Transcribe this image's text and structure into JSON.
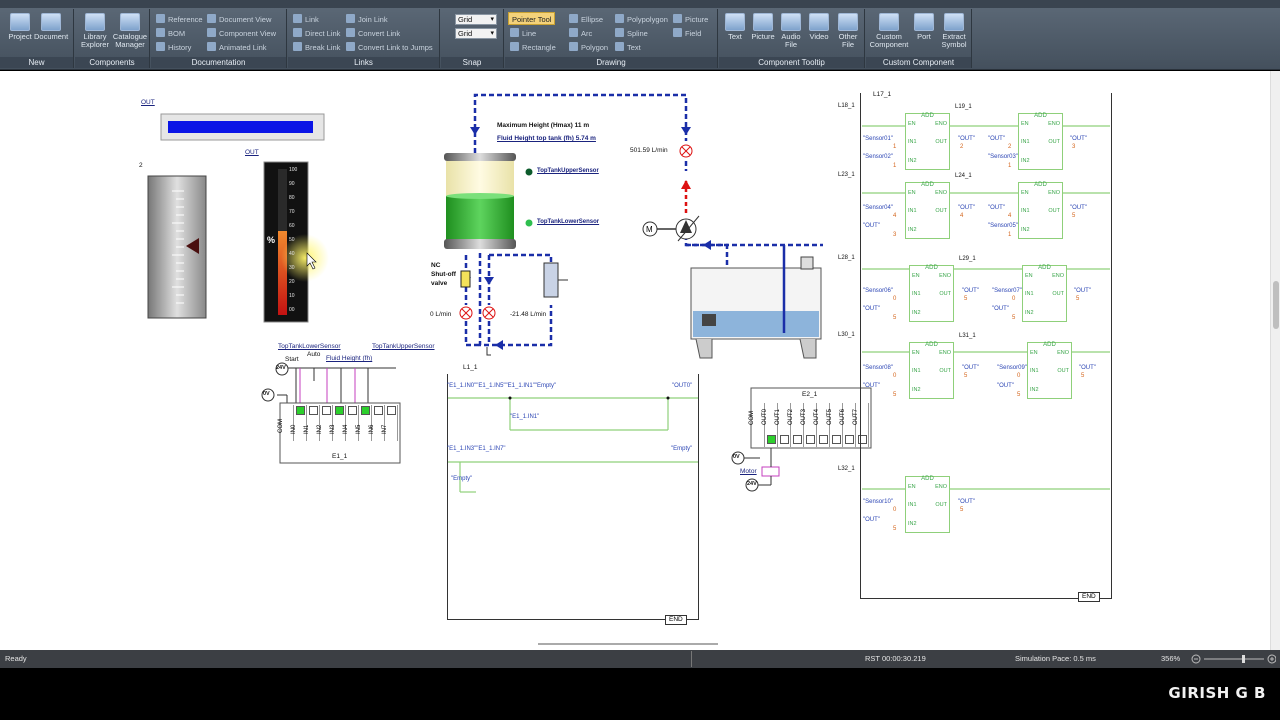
{
  "ribbon": {
    "groups": [
      {
        "title": "New",
        "buttons": [
          "Project",
          "Document"
        ]
      },
      {
        "title": "Components",
        "buttons": [
          "Library Explorer",
          "Catalogue Manager"
        ]
      },
      {
        "title": "Documentation",
        "small": [
          "Reference",
          "BOM",
          "History",
          "Document View",
          "Component View",
          "Animated Link"
        ]
      },
      {
        "title": "Links",
        "small": [
          "Link",
          "Direct Link",
          "Break Link",
          "Join Link",
          "Convert Link",
          "Convert Link to Jumps"
        ]
      },
      {
        "title": "Snap",
        "combos": [
          "Grid",
          "Grid"
        ]
      },
      {
        "title": "Drawing",
        "small": [
          "Pointer Tool",
          "Line",
          "Rectangle",
          "Ellipse",
          "Arc",
          "Polygon",
          "Polypolygon",
          "Spline",
          "Text",
          "Picture",
          "Field"
        ]
      },
      {
        "title": "Component Tooltip",
        "buttons": [
          "Text",
          "Picture",
          "Audio File",
          "Video",
          "Other File"
        ]
      },
      {
        "title": "Custom Component",
        "buttons": [
          "Custom Component",
          "Port",
          "Extract Symbol"
        ]
      }
    ]
  },
  "canvas": {
    "out_label_1": "OUT",
    "out_label_2": "OUT",
    "gauge_number": "2",
    "bargraph_unit": "%",
    "bargraph_ticks": [
      "100",
      "90",
      "80",
      "70",
      "60",
      "50",
      "40",
      "30",
      "20",
      "10",
      "00"
    ],
    "tank": {
      "max_height": "Maximum Height (Hmax) 11 m",
      "fluid_height_top": "Fluid Height top tank (fh) 5.74 m",
      "upper_sensor": "TopTankUpperSensor",
      "lower_sensor": "TopTankLowerSensor",
      "valve_label": [
        "NC",
        "Shut-off",
        "valve"
      ],
      "flow_left": "0 L/min",
      "flow_right": "-21.48 L/min",
      "flow_top": "501.59 L/min"
    },
    "io_panel": {
      "lower_sensor": "TopTankLowerSensor",
      "upper_sensor": "TopTankUpperSensor",
      "start": "Start",
      "auto": "Auto",
      "fluid_height": "Fluid Height (fh)",
      "v24": "24V",
      "v0": "0V",
      "module": "E1_1",
      "com": "COM",
      "inputs": [
        "IN0",
        "IN1",
        "IN2",
        "IN3",
        "IN4",
        "IN5",
        "IN6",
        "IN7"
      ],
      "active": [
        true,
        false,
        false,
        true,
        false,
        true,
        false,
        false
      ]
    },
    "ladder_middle": {
      "name": "L1_1",
      "row1": "\"E1_1.IN0\"\"E1_1.IN5\"\"E1_1.IN1\"\"Empty\"",
      "row1_out": "\"OUT0\"",
      "row2": "\"E1_1.IN1\"",
      "row3": "\"E1_1.IN3\"\"E1_1.IN7\"",
      "row3_out": "\"Empty\"",
      "row4": "\"Empty\"",
      "end": "END"
    },
    "out_module": {
      "module": "E2_1",
      "com": "COM",
      "outputs": [
        "OUT0",
        "OUT1",
        "OUT2",
        "OUT3",
        "OUT4",
        "OUT5",
        "OUT6",
        "OUT7"
      ],
      "v0": "0V",
      "v24": "24V",
      "motor": "Motor"
    },
    "ladder_right": {
      "rungs": [
        {
          "name": "L18_1",
          "blk2": "L19_1",
          "in1": "\"Sensor01\"",
          "in2": "\"Sensor02\"",
          "v1": "1",
          "v2": "1",
          "out": "\"OUT\"",
          "outv": "2",
          "in3": "\"OUT\"",
          "in4": "\"Sensor03\"",
          "v3": "2",
          "v4": "1",
          "out2": "\"OUT\"",
          "outv2": "3"
        },
        {
          "name": "L23_1",
          "blk2": "L24_1",
          "in1": "\"Sensor04\"",
          "in2": "\"OUT\"",
          "v1": "4",
          "v2": "3",
          "out": "\"OUT\"",
          "outv": "4",
          "in3": "\"OUT\"",
          "in4": "\"Sensor05\"",
          "v3": "4",
          "v4": "1",
          "out2": "\"OUT\"",
          "outv2": "5"
        },
        {
          "name": "L28_1",
          "blk2": "L29_1",
          "in1": "\"Sensor06\"",
          "in2": "\"OUT\"",
          "v1": "0",
          "v2": "5",
          "out": "\"OUT\"",
          "outv": "5",
          "in3": "\"Sensor07\"",
          "in4": "\"OUT\"",
          "v3": "0",
          "v4": "5",
          "out2": "\"OUT\"",
          "outv2": "5"
        },
        {
          "name": "L30_1",
          "blk2": "L31_1",
          "in1": "\"Sensor08\"",
          "in2": "\"OUT\"",
          "v1": "0",
          "v2": "5",
          "out": "\"OUT\"",
          "outv": "5",
          "in3": "\"Sensor09\"",
          "in4": "\"OUT\"",
          "v3": "0",
          "v4": "5",
          "out2": "\"OUT\"",
          "outv2": "5"
        },
        {
          "name": "L32_1",
          "in1": "\"Sensor10\"",
          "in2": "\"OUT\"",
          "v1": "0",
          "v2": "5",
          "out": "\"OUT\"",
          "outv": "5"
        }
      ],
      "top_label": "L17_1",
      "block_title": "ADD",
      "en": "EN",
      "eno": "ENO",
      "in1": "IN1",
      "in2": "IN2",
      "out": "OUT",
      "end": "END"
    }
  },
  "status": {
    "ready": "Ready",
    "rst": "RST 00:00:30.219",
    "pace": "Simulation Pace: 0.5 ms",
    "zoom": "356%"
  },
  "watermark": "GIRISH G B",
  "colors": {
    "ribbon": "#4d5967",
    "accent_blue": "#0a14e6",
    "ladder_green": "#8fd07a",
    "pipe_blue": "#1a2ea8",
    "tank_green": "#27a327"
  }
}
